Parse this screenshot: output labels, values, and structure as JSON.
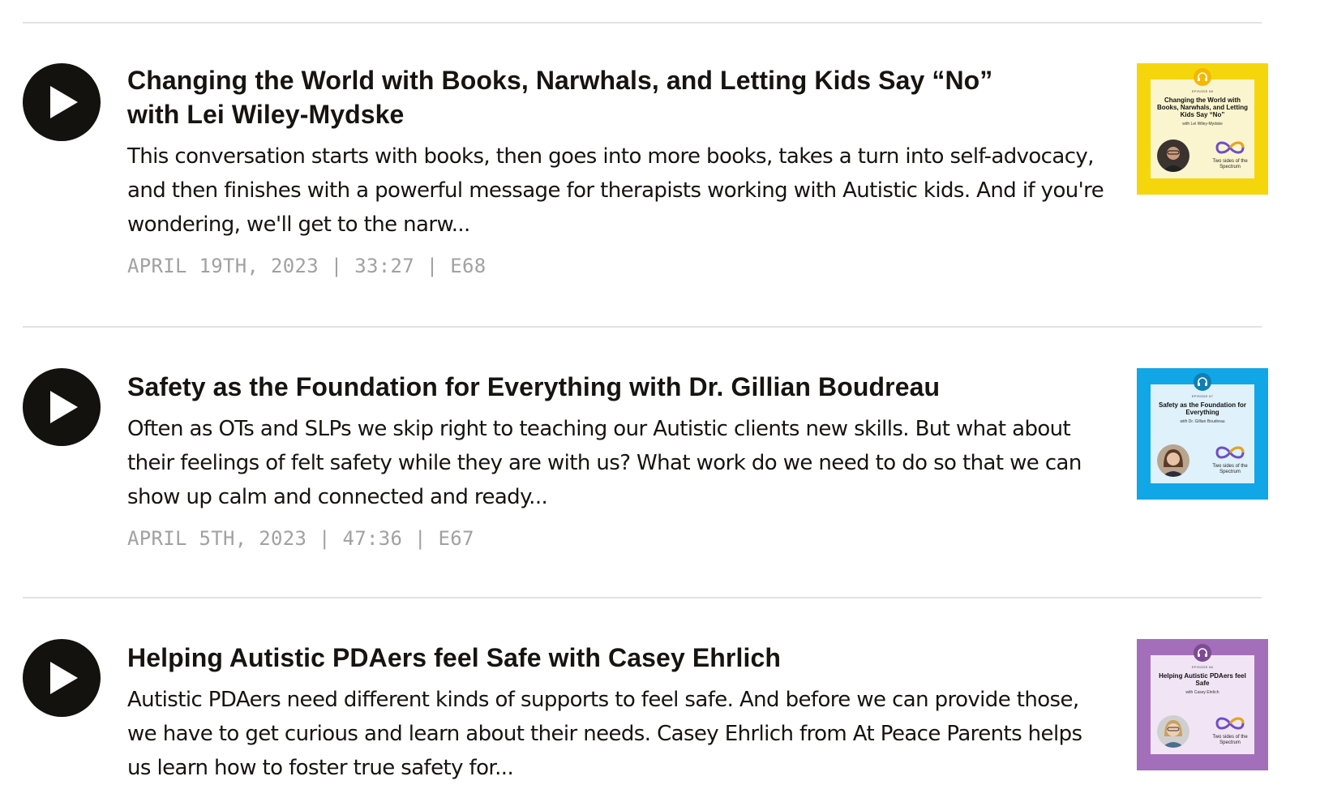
{
  "colors": {
    "play_button": "#13120e",
    "divider": "#e2e2e2",
    "meta_text": "#a1a1a1"
  },
  "episodes": [
    {
      "title_line1": "Changing the World with Books, Narwhals, and Letting Kids Say “No”",
      "title_line2": "with Lei Wiley-Mydske",
      "description": "This conversation starts with books, then goes into more books, takes a turn into self-advocacy, and then finishes with a powerful message for therapists working with Autistic kids. And if you're wondering, we'll get to the narw...",
      "meta": "APRIL 19TH, 2023 | 33:27 | E68",
      "thumb": {
        "border_color": "#f5d60c",
        "card_color": "#fbf5cf",
        "accent": "#f5b800",
        "episode_label": "EPISODE 68",
        "title": "Changing the World with Books, Narwhals, and Letting Kids Say “No”",
        "guest": "with Lei Wiley-Mydske",
        "logo_text": "Two sides of the Spectrum"
      }
    },
    {
      "title_line1": "Safety as the Foundation for Everything with Dr. Gillian Boudreau",
      "description": "Often as OTs and SLPs we skip right to teaching our Autistic clients new skills. But what about their feelings of felt safety while they are with us? What work do we need to do so that we can show up calm and connected and ready...",
      "meta": "APRIL 5TH, 2023 | 47:36 | E67",
      "thumb": {
        "border_color": "#11a6e6",
        "card_color": "#dff1fa",
        "accent": "#0f7fb4",
        "episode_label": "EPISODE 67",
        "title": "Safety as the Foundation for Everything",
        "guest": "with Dr. Gillian Boudreau",
        "logo_text": "Two sides of the Spectrum"
      }
    },
    {
      "title_line1": "Helping Autistic PDAers feel Safe with Casey Ehrlich",
      "description": "Autistic PDAers need different kinds of supports to feel safe. And before we can provide those, we have to get curious and learn about their needs. Casey Ehrlich from At Peace Parents helps us learn how to foster true safety for...",
      "meta": "",
      "thumb": {
        "border_color": "#a46fba",
        "card_color": "#f1e5f5",
        "accent": "#7d4b94",
        "episode_label": "EPISODE 66",
        "title": "Helping Autistic PDAers feel Safe",
        "guest": "with Casey Ehrlich",
        "logo_text": "Two sides of the Spectrum"
      }
    }
  ]
}
